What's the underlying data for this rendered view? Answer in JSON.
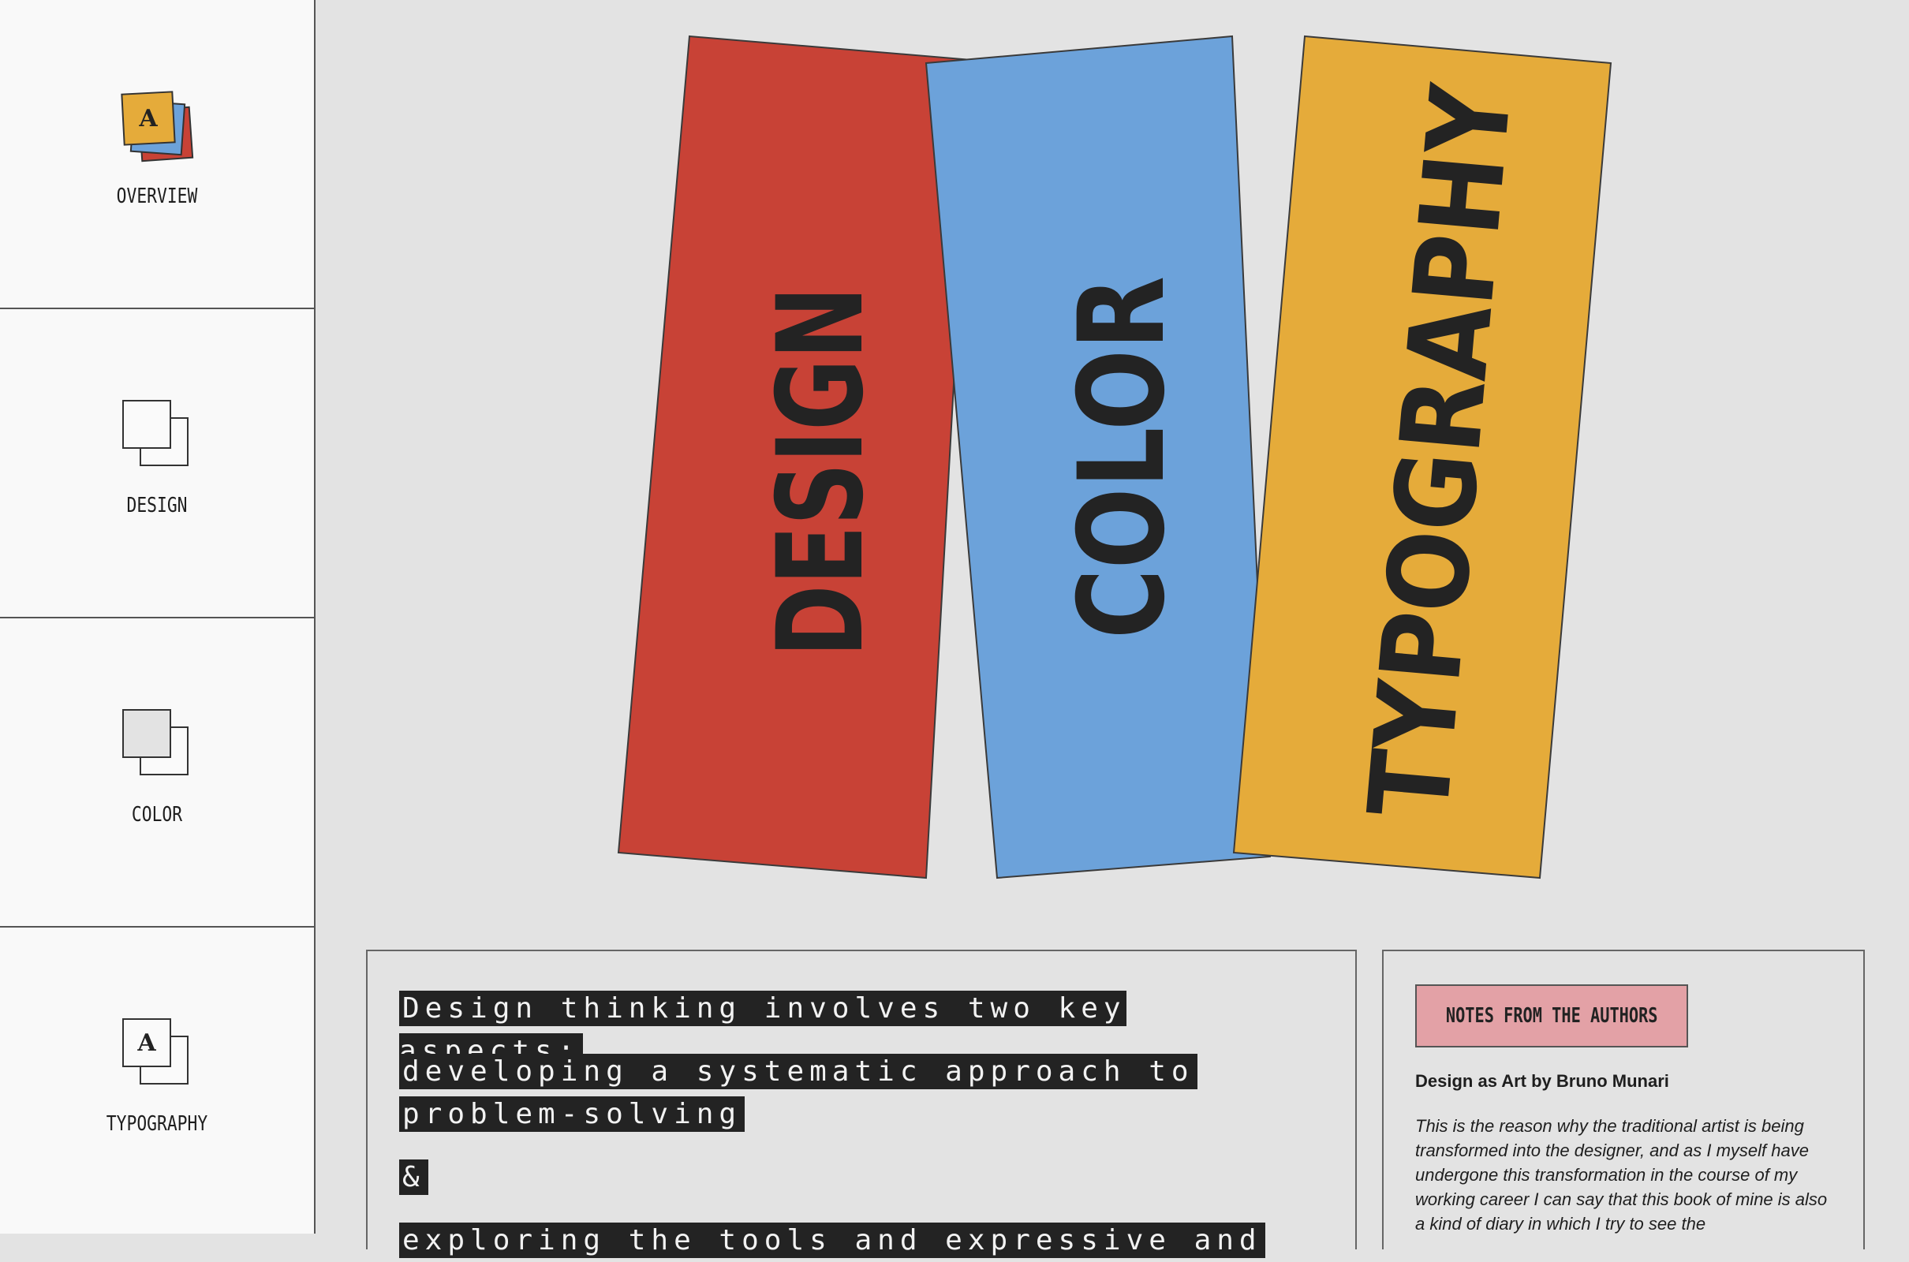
{
  "sidebar": {
    "items": [
      {
        "label": "OVERVIEW",
        "icon": "overview-stack-icon",
        "icon_letter": "A",
        "active": true
      },
      {
        "label": "DESIGN",
        "icon": "design-squares-icon"
      },
      {
        "label": "COLOR",
        "icon": "color-squares-icon"
      },
      {
        "label": "TYPOGRAPHY",
        "icon": "typography-squares-icon",
        "icon_letter": "A"
      }
    ]
  },
  "hero": {
    "cards": [
      {
        "word": "DESIGN",
        "color": "#c84236"
      },
      {
        "word": "COLOR",
        "color": "#6ca2da"
      },
      {
        "word": "TYPOGRAPHY",
        "color": "#e5ab3a"
      }
    ]
  },
  "intro": {
    "line1": "Design thinking involves two key aspects:",
    "line2": "developing a systematic approach to",
    "line3": "problem-solving",
    "amp": "&",
    "line4": "exploring the tools and expressive and"
  },
  "notes": {
    "badge": "NOTES FROM THE AUTHORS",
    "book": "Design as Art by Bruno Munari",
    "quote": "This is the reason why the traditional artist is being transformed into the designer, and as I myself have undergone this transformation in the course of my working career I can say that this book of mine is also a kind of diary in which I try to see the"
  },
  "colors": {
    "red": "#c84236",
    "blue": "#6ca2da",
    "yellow": "#e5ab3a",
    "ink": "#232323",
    "pink": "#e3a1a6"
  }
}
